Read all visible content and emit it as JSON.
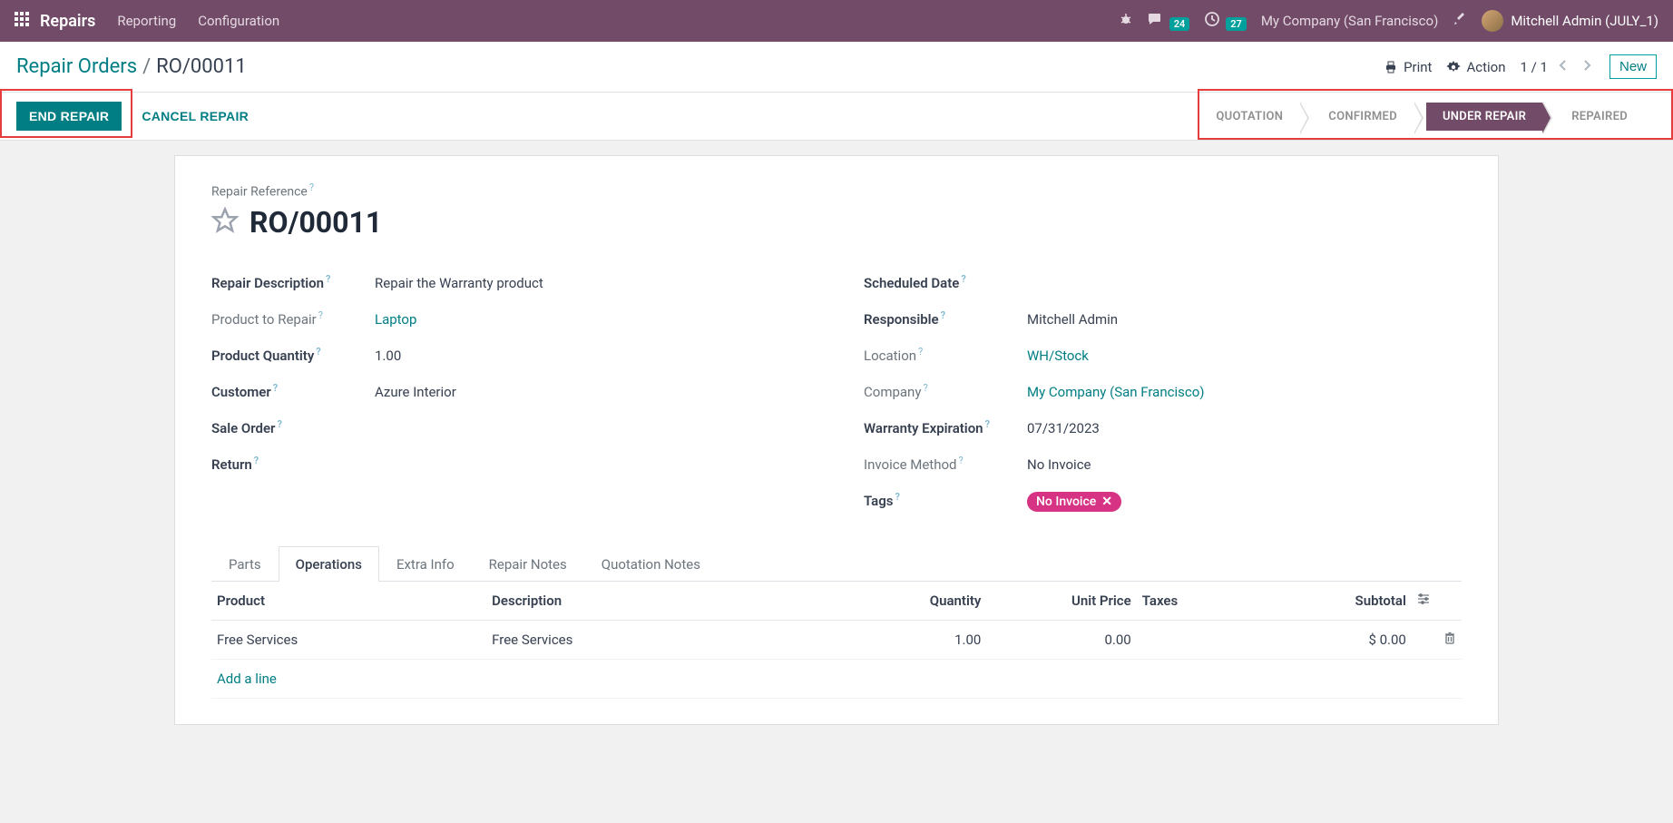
{
  "nav": {
    "brand": "Repairs",
    "menu": [
      "Reporting",
      "Configuration"
    ],
    "messages_count": "24",
    "activities_count": "27",
    "company": "My Company (San Francisco)",
    "user": "Mitchell Admin (JULY_1)"
  },
  "cp": {
    "breadcrumb_root": "Repair Orders",
    "breadcrumb_current": "RO/00011",
    "print": "Print",
    "action": "Action",
    "pager": "1 / 1",
    "new": "New"
  },
  "statusbar": {
    "end_repair": "END REPAIR",
    "cancel_repair": "CANCEL REPAIR",
    "stages": [
      "QUOTATION",
      "CONFIRMED",
      "UNDER REPAIR",
      "REPAIRED"
    ],
    "active_index": 2
  },
  "form": {
    "title_label": "Repair Reference",
    "title_value": "RO/00011",
    "left": {
      "repair_description_label": "Repair Description",
      "repair_description": "Repair the Warranty  product",
      "product_to_repair_label": "Product to Repair",
      "product_to_repair": "Laptop",
      "product_quantity_label": "Product Quantity",
      "product_quantity": "1.00",
      "customer_label": "Customer",
      "customer": "Azure Interior",
      "sale_order_label": "Sale Order",
      "sale_order": "",
      "return_label": "Return",
      "return": ""
    },
    "right": {
      "scheduled_date_label": "Scheduled Date",
      "scheduled_date": "",
      "responsible_label": "Responsible",
      "responsible": "Mitchell Admin",
      "location_label": "Location",
      "location": "WH/Stock",
      "company_label": "Company",
      "company": "My Company (San Francisco)",
      "warranty_expiration_label": "Warranty Expiration",
      "warranty_expiration": "07/31/2023",
      "invoice_method_label": "Invoice Method",
      "invoice_method": "No Invoice",
      "tags_label": "Tags",
      "tag_value": "No Invoice"
    }
  },
  "tabs": [
    "Parts",
    "Operations",
    "Extra Info",
    "Repair Notes",
    "Quotation Notes"
  ],
  "active_tab": 1,
  "table": {
    "headers": {
      "product": "Product",
      "description": "Description",
      "quantity": "Quantity",
      "unit_price": "Unit Price",
      "taxes": "Taxes",
      "subtotal": "Subtotal"
    },
    "rows": [
      {
        "product": "Free Services",
        "description": "Free Services",
        "quantity": "1.00",
        "unit_price": "0.00",
        "taxes": "",
        "subtotal": "$ 0.00"
      }
    ],
    "add_line": "Add a line"
  }
}
